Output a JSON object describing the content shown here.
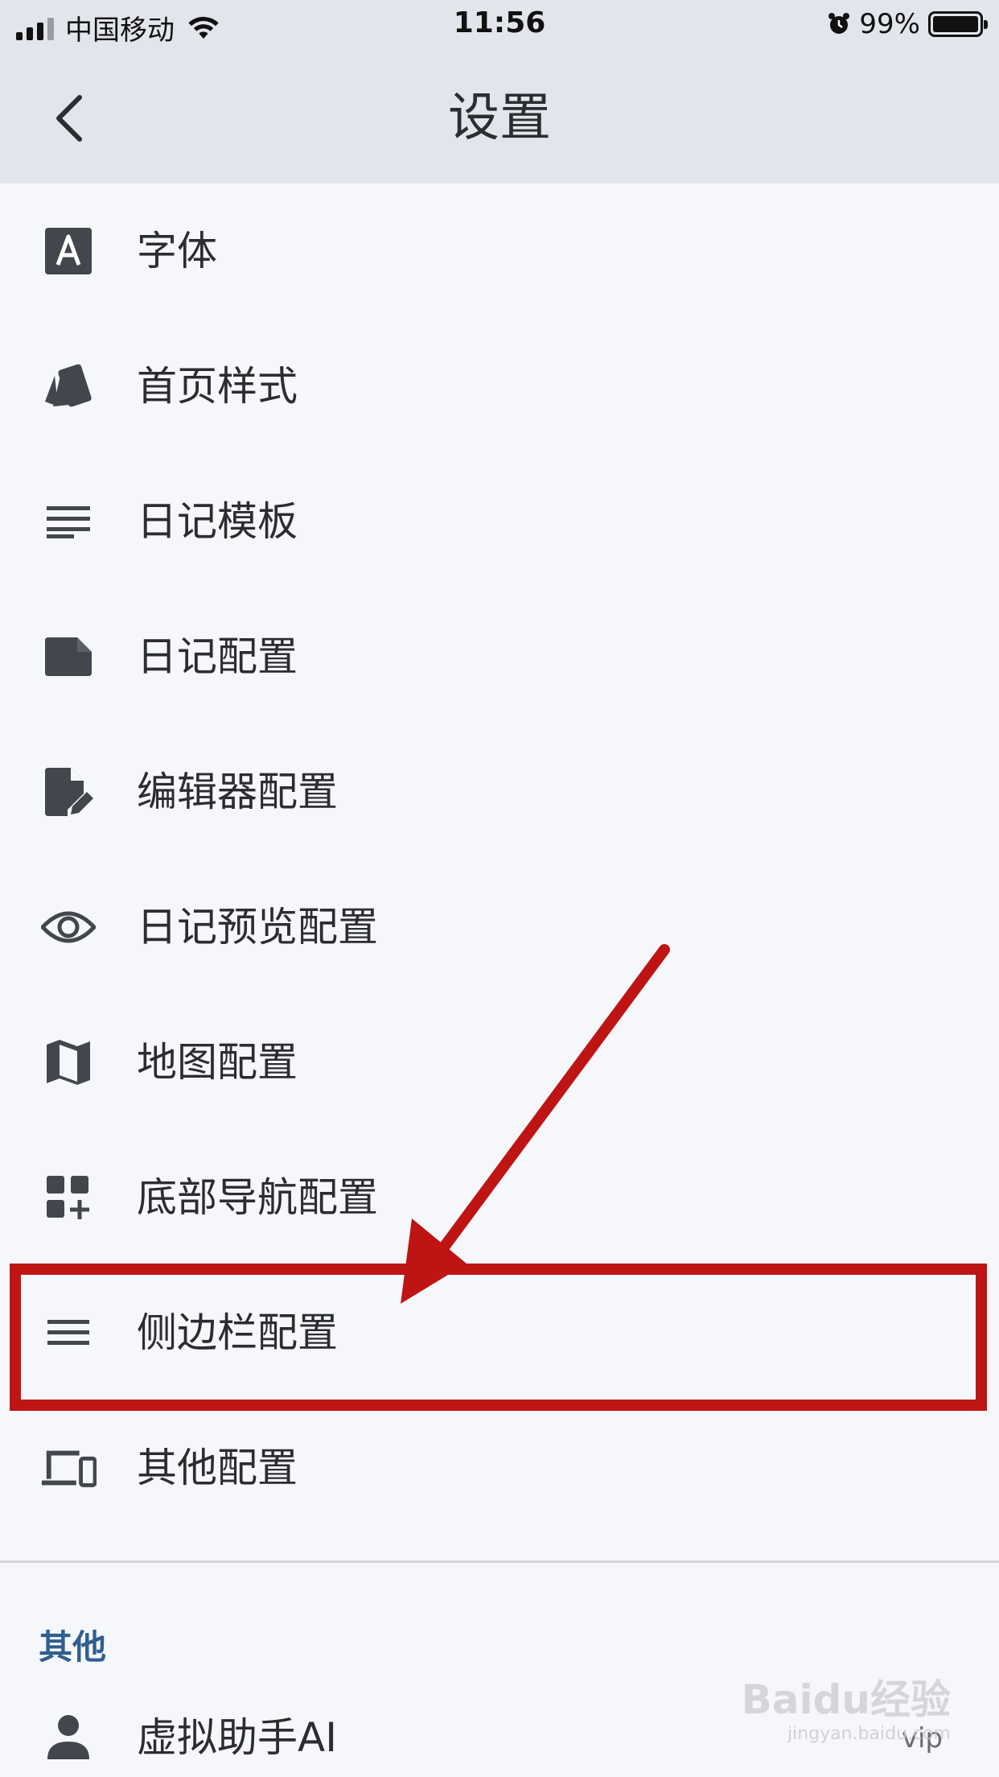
{
  "status_bar": {
    "carrier": "中国移动",
    "time": "11:56",
    "battery_percent": "99%"
  },
  "header": {
    "title": "设置",
    "back_icon": "chevron-left-icon"
  },
  "settings_items": [
    {
      "label": "字体",
      "icon": "font-icon"
    },
    {
      "label": "首页样式",
      "icon": "style-cards-icon"
    },
    {
      "label": "日记模板",
      "icon": "text-lines-icon"
    },
    {
      "label": "日记配置",
      "icon": "note-icon"
    },
    {
      "label": "编辑器配置",
      "icon": "edit-document-icon"
    },
    {
      "label": "日记预览配置",
      "icon": "eye-icon"
    },
    {
      "label": "地图配置",
      "icon": "map-icon"
    },
    {
      "label": "底部导航配置",
      "icon": "widgets-add-icon"
    },
    {
      "label": "侧边栏配置",
      "icon": "menu-icon"
    },
    {
      "label": "其他配置",
      "icon": "devices-icon"
    }
  ],
  "other_section": {
    "title": "其他",
    "items": [
      {
        "label": "虚拟助手AI",
        "icon": "person-icon",
        "badge": "vip"
      }
    ]
  },
  "watermark": {
    "text": "Baidu经验",
    "sub": "jingyan.baidu.com"
  },
  "colors": {
    "background": "#f6f7fb",
    "header": "#e3e5ec",
    "text": "#2b2d31",
    "section_title": "#2e5f8f",
    "annotation": "#bf1414"
  }
}
